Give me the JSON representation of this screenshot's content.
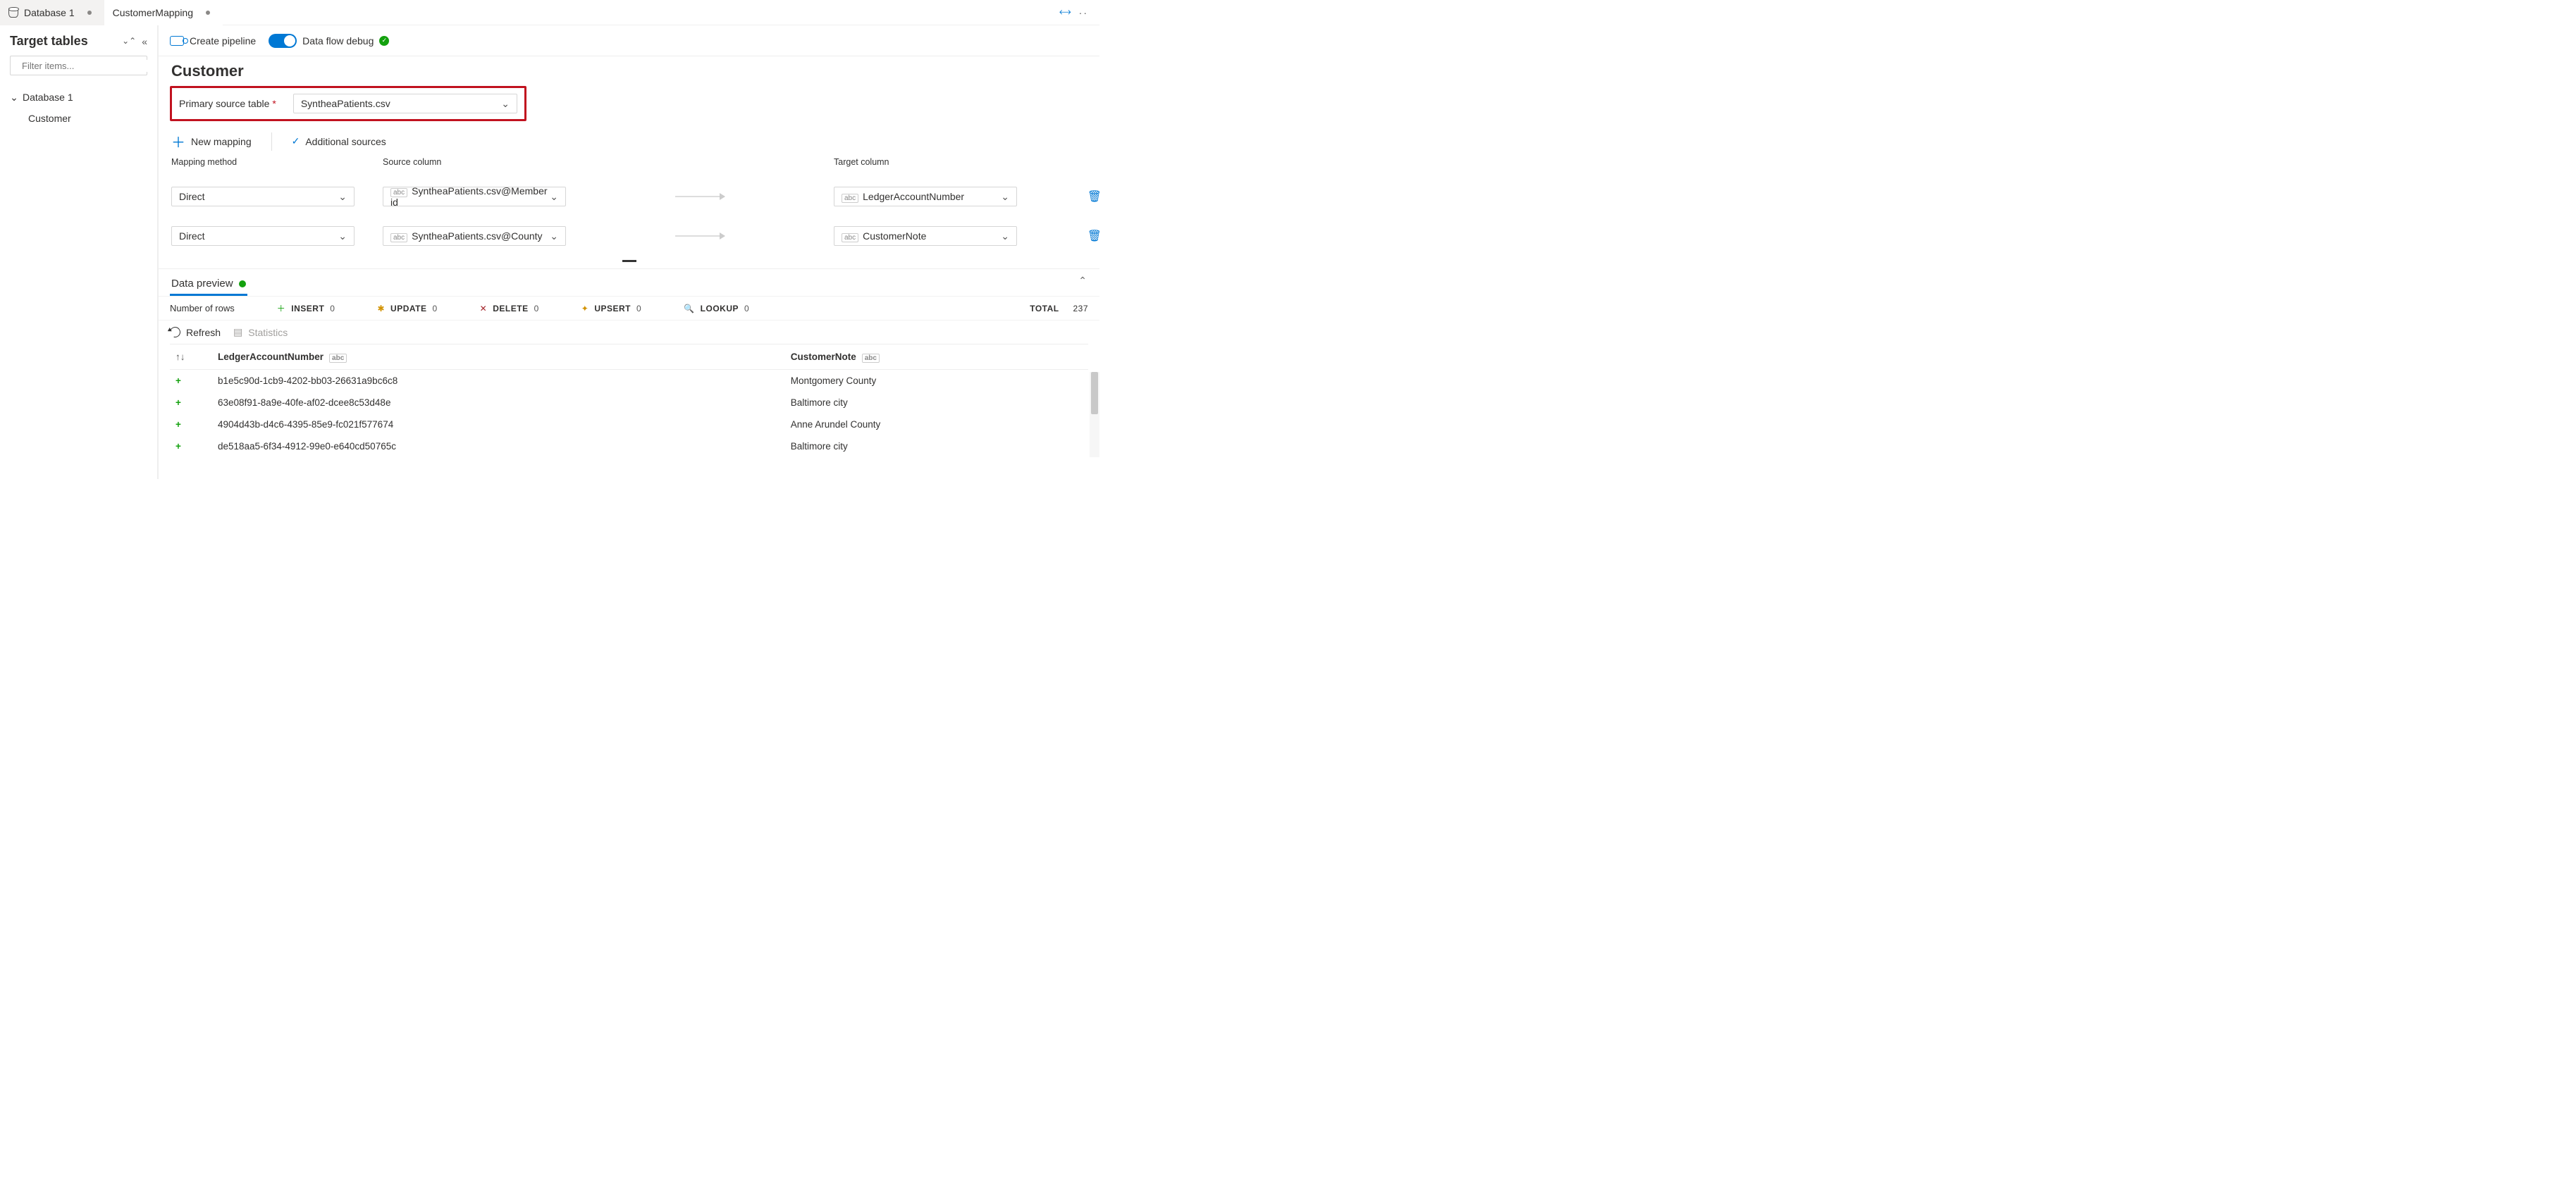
{
  "tabs": [
    {
      "label": "Database 1",
      "active": false,
      "dirty": true,
      "icon": "database"
    },
    {
      "label": "CustomerMapping",
      "active": true,
      "dirty": true,
      "icon": ""
    }
  ],
  "sidebar": {
    "title": "Target tables",
    "filter_placeholder": "Filter items...",
    "tree": {
      "root_label": "Database 1",
      "children": [
        {
          "label": "Customer"
        }
      ]
    }
  },
  "toolbar": {
    "create_pipeline_label": "Create pipeline",
    "debug_label": "Data flow debug",
    "debug_on": true,
    "debug_status": "ok"
  },
  "entity": {
    "title": "Customer",
    "primary_source_label": "Primary source table",
    "primary_source_required": true,
    "primary_source_value": "SyntheaPatients.csv"
  },
  "mapping_actions": {
    "new_mapping_label": "New mapping",
    "additional_sources_label": "Additional sources"
  },
  "mapping_headers": {
    "method": "Mapping method",
    "source": "Source column",
    "target": "Target column"
  },
  "mappings": [
    {
      "method": "Direct",
      "source_type": "abc",
      "source": "SyntheaPatients.csv@Member id",
      "target_type": "abc",
      "target": "LedgerAccountNumber"
    },
    {
      "method": "Direct",
      "source_type": "abc",
      "source": "SyntheaPatients.csv@County",
      "target_type": "abc",
      "target": "CustomerNote"
    }
  ],
  "preview": {
    "tab_label": "Data preview",
    "rows_label": "Number of rows",
    "stats": {
      "insert": {
        "label": "INSERT",
        "value": "0"
      },
      "update": {
        "label": "UPDATE",
        "value": "0"
      },
      "delete": {
        "label": "DELETE",
        "value": "0"
      },
      "upsert": {
        "label": "UPSERT",
        "value": "0"
      },
      "lookup": {
        "label": "LOOKUP",
        "value": "0"
      },
      "total": {
        "label": "TOTAL",
        "value": "237"
      }
    },
    "tools": {
      "refresh_label": "Refresh",
      "statistics_label": "Statistics"
    },
    "columns": [
      {
        "name": "LedgerAccountNumber",
        "type": "abc"
      },
      {
        "name": "CustomerNote",
        "type": "abc"
      }
    ],
    "rows": [
      {
        "op": "+",
        "cells": [
          "b1e5c90d-1cb9-4202-bb03-26631a9bc6c8",
          "Montgomery County"
        ]
      },
      {
        "op": "+",
        "cells": [
          "63e08f91-8a9e-40fe-af02-dcee8c53d48e",
          "Baltimore city"
        ]
      },
      {
        "op": "+",
        "cells": [
          "4904d43b-d4c6-4395-85e9-fc021f577674",
          "Anne Arundel County"
        ]
      },
      {
        "op": "+",
        "cells": [
          "de518aa5-6f34-4912-99e0-e640cd50765c",
          "Baltimore city"
        ]
      }
    ]
  }
}
